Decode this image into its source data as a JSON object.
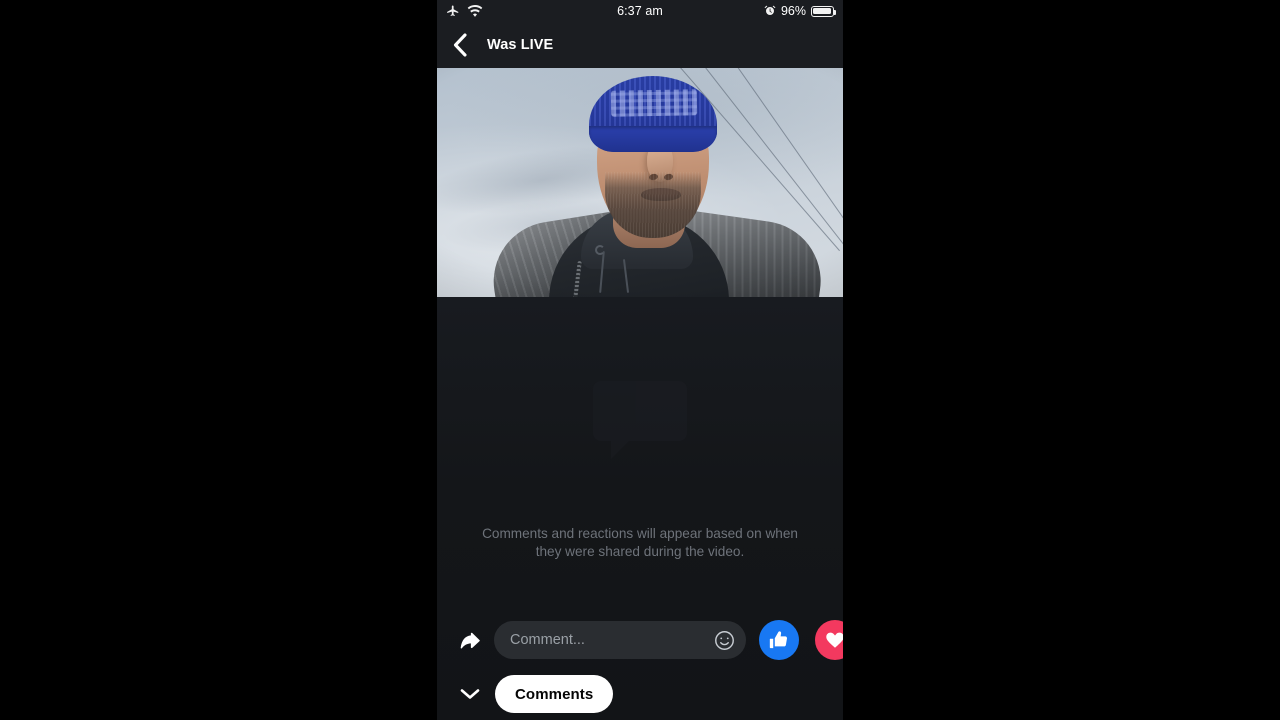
{
  "status_bar": {
    "airplane_icon": "airplane-mode-icon",
    "wifi_icon": "wifi-icon",
    "time": "6:37 am",
    "alarm_icon": "alarm-clock-icon",
    "battery_percent": "96%",
    "battery_icon": "battery-full-icon"
  },
  "nav": {
    "back_icon": "chevron-left-icon",
    "title": "Was LIVE"
  },
  "video": {
    "alt": "Man wearing a blue knit beanie filming a selfie video outdoors under an overcast sky with power lines",
    "state": "playing"
  },
  "empty_state": {
    "icon": "speech-bubble-icon",
    "message_line1": "Comments and reactions will appear based on",
    "message_line2": "when they were shared during the video.",
    "message": "Comments and reactions will appear based on when they were shared during the video."
  },
  "composer": {
    "share_icon": "share-arrow-icon",
    "input_placeholder": "Comment...",
    "input_value": "",
    "emoji_icon": "emoji-smiley-icon",
    "reactions": [
      {
        "name": "like",
        "icon": "thumbs-up-icon",
        "color": "#1878f3"
      },
      {
        "name": "love",
        "icon": "heart-icon",
        "color": "#f3395f"
      }
    ]
  },
  "bottom_bar": {
    "collapse_icon": "chevron-down-icon",
    "comments_tab_label": "Comments"
  },
  "colors": {
    "app_background": "#141619",
    "bar_background": "#1b1d21",
    "like_blue": "#1878f3",
    "love_pink": "#f3395f",
    "placeholder_text": "#9aa0a6",
    "empty_text": "#6e737a",
    "pill_background": "#ffffff"
  }
}
